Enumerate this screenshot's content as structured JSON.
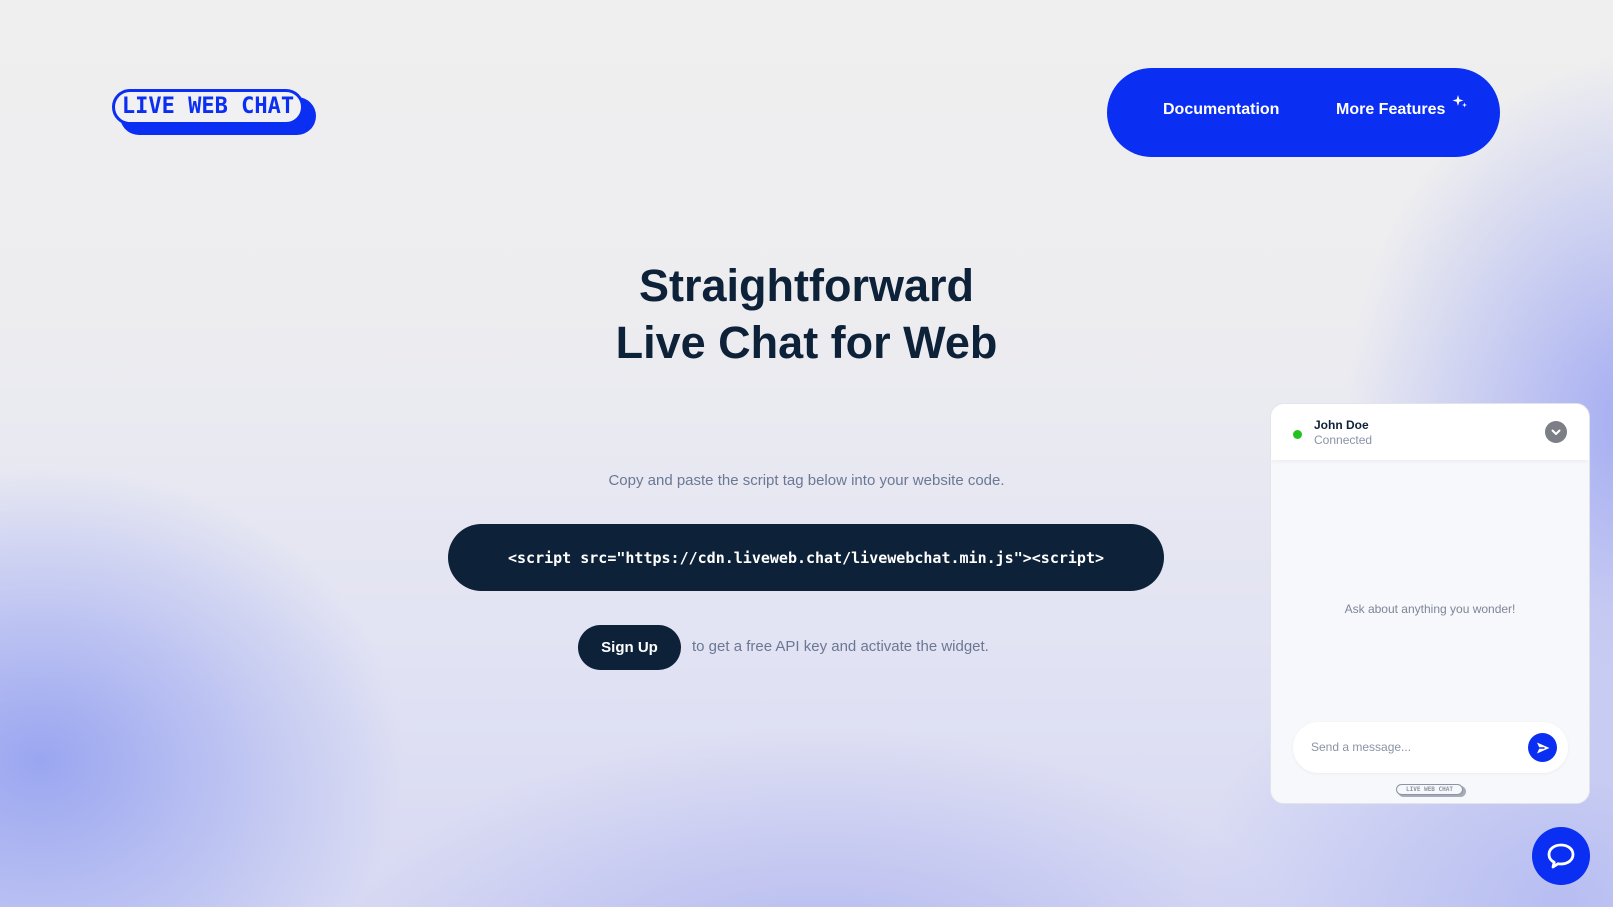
{
  "brand": {
    "logo_text": "LIVE WEB CHAT",
    "accent_color": "#0a2ef2",
    "dark_color": "#0d2238"
  },
  "nav": {
    "items": [
      {
        "label": "Documentation"
      },
      {
        "label": "More Features",
        "icon": "sparkle-icon"
      }
    ]
  },
  "hero": {
    "title_line1": "Straightforward",
    "title_line2": "Live Chat for Web"
  },
  "install": {
    "instructions": "Copy and paste the script tag below into your website code.",
    "script_tag": "<script src=\"https://cdn.liveweb.chat/livewebchat.min.js\"><script>",
    "signup_label": "Sign Up",
    "signup_hint": "to get a free API key and activate the widget."
  },
  "widget": {
    "agent_name": "John Doe",
    "agent_status": "Connected",
    "status_color": "#22c31f",
    "collapse_icon": "chevron-down-icon",
    "empty_message": "Ask about anything you wonder!",
    "input_placeholder": "Send a message...",
    "send_icon": "send-icon",
    "footer_logo_text": "LIVE WEB CHAT"
  },
  "launcher": {
    "icon": "chat-bubble-icon"
  }
}
